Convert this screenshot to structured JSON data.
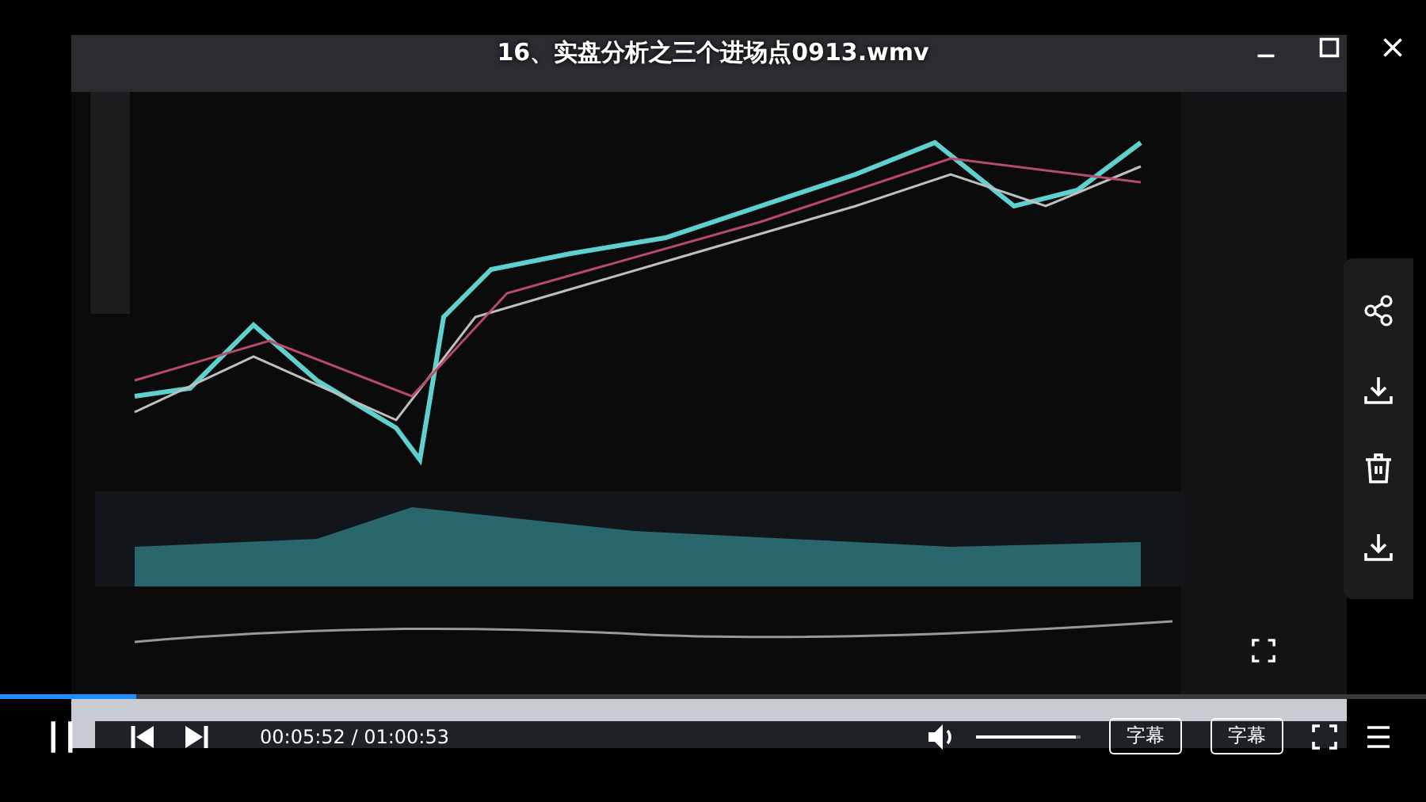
{
  "window": {
    "title": "16、实盘分析之三个进场点0913.wmv"
  },
  "progress": {
    "level": 0.096
  },
  "player": {
    "current_time": "00:05:52",
    "separator": "/",
    "duration": "01:00:53",
    "volume": {
      "level": 0.95
    },
    "buttons": [
      "字幕",
      "字幕"
    ]
  }
}
